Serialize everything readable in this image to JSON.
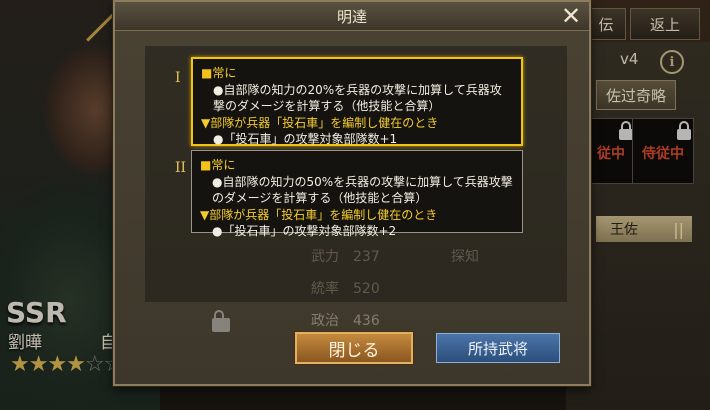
{
  "background": {
    "rarity": "SSR",
    "hero_name": "劉曄",
    "hero_extra": "自",
    "stars_on": "★★★★",
    "stars_off": "☆☆☆",
    "top_tabs": [
      "伝",
      "返上"
    ],
    "level": "v4",
    "info_icon_text": "i",
    "skill_name": "佐过奇略",
    "slot_labels": [
      "従中",
      "侍従中"
    ],
    "officer": "王佐",
    "faded_stats": [
      {
        "label": "武力",
        "value": "237"
      },
      {
        "label": "統率",
        "value": "520"
      },
      {
        "label": "政治",
        "value": "436"
      },
      {
        "label": "探知",
        "value": ""
      }
    ]
  },
  "dialog": {
    "title": "明達",
    "close_glyph": "✕",
    "levels": [
      {
        "numeral": "I",
        "always": "常に",
        "effect": "自部隊の知力の20%を兵器の攻撃に加算して兵器攻撃のダメージを計算する（他技能と合算）",
        "condition": "部隊が兵器「投石車」を編制し健在のとき",
        "bonus": "「投石車」の攻撃対象部隊数+1"
      },
      {
        "numeral": "II",
        "always": "常に",
        "effect": "自部隊の知力の50%を兵器の攻撃に加算して兵器攻撃のダメージを計算する（他技能と合算）",
        "condition": "部隊が兵器「投石車」を編制し健在のとき",
        "bonus": "「投石車」の攻撃対象部隊数+2"
      }
    ],
    "close_button": "閉じる",
    "owned_button": "所持武将"
  }
}
